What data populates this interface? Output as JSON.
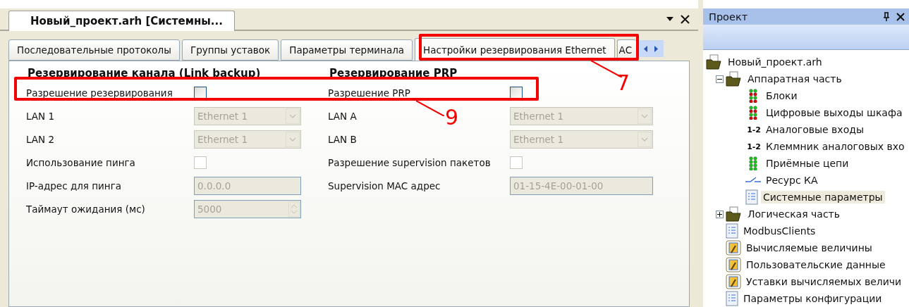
{
  "document_tab": {
    "title": "Новый_проект.arh [Системны..."
  },
  "tabs": [
    {
      "label": "Последовательные протоколы",
      "selected": false
    },
    {
      "label": "Группы уставок",
      "selected": false
    },
    {
      "label": "Параметры терминала",
      "selected": false
    },
    {
      "label": "Настройки резервирования Ethernet",
      "selected": true
    },
    {
      "label": "АС",
      "selected": false
    }
  ],
  "sections": [
    {
      "heading": "Резервирование канала (Link backup)",
      "rows": [
        {
          "kind": "checkbox",
          "label": "Разрешение резервирования",
          "checked": false,
          "disabled": false
        },
        {
          "kind": "select",
          "label": "LAN 1",
          "value": "Ethernet 1",
          "disabled": true
        },
        {
          "kind": "select",
          "label": "LAN 2",
          "value": "Ethernet 1",
          "disabled": true
        },
        {
          "kind": "checkbox",
          "label": "Использование пинга",
          "checked": false,
          "disabled": true
        },
        {
          "kind": "input",
          "label": "IP-адрес для пинга",
          "value": "0.0.0.0",
          "disabled": true
        },
        {
          "kind": "spinner",
          "label": "Таймаут ожидания (мс)",
          "value": "5000",
          "disabled": true
        }
      ]
    },
    {
      "heading": "Резервирование PRP",
      "rows": [
        {
          "kind": "checkbox",
          "label": "Разрешение PRP",
          "checked": false,
          "disabled": false
        },
        {
          "kind": "select",
          "label": "LAN A",
          "value": "Ethernet 1",
          "disabled": true
        },
        {
          "kind": "select",
          "label": "LAN B",
          "value": "Ethernet 1",
          "disabled": true
        },
        {
          "kind": "checkbox",
          "label": "Разрешение supervision пакетов",
          "checked": false,
          "disabled": true
        },
        {
          "kind": "input",
          "label": "Supervision MAC адрес",
          "value": "01-15-4E-00-01-00",
          "disabled": true
        }
      ]
    }
  ],
  "callouts": [
    {
      "label": "7"
    },
    {
      "label": "9"
    }
  ],
  "project_panel": {
    "title": "Проект",
    "tree": [
      {
        "label": "Новый_проект.arh",
        "kind": "folder",
        "selected": false,
        "children": [
          {
            "label": "Аппаратная часть",
            "kind": "folder",
            "selected": false,
            "expanded": true,
            "children": [
              {
                "label": "Блоки",
                "kind": "leds",
                "selected": false
              },
              {
                "label": "Цифровые выходы шкафа",
                "kind": "leds",
                "selected": false
              },
              {
                "label": "Аналоговые входы",
                "kind": "numbers",
                "icon_text": "1-2",
                "selected": false
              },
              {
                "label": "Клеммник аналоговых вхо",
                "kind": "numbers",
                "icon_text": "1-2",
                "selected": false
              },
              {
                "label": "Приёмные цепи",
                "kind": "leds-green",
                "selected": false
              },
              {
                "label": "Ресурс КА",
                "kind": "switch",
                "selected": false
              },
              {
                "label": "Системные параметры",
                "kind": "doc",
                "selected": true
              }
            ]
          },
          {
            "label": "Логическая часть",
            "kind": "folder",
            "selected": false,
            "expanded": false
          },
          {
            "label": "ModbusClients",
            "kind": "doc",
            "selected": false
          },
          {
            "label": "Вычисляемые величины",
            "kind": "calc",
            "selected": false
          },
          {
            "label": "Пользовательские данные",
            "kind": "calc",
            "selected": false
          },
          {
            "label": "Уставки вычисляемых величи",
            "kind": "calc",
            "selected": false
          },
          {
            "label": "Параметры конфигурации",
            "kind": "doc",
            "selected": false
          }
        ]
      }
    ]
  }
}
